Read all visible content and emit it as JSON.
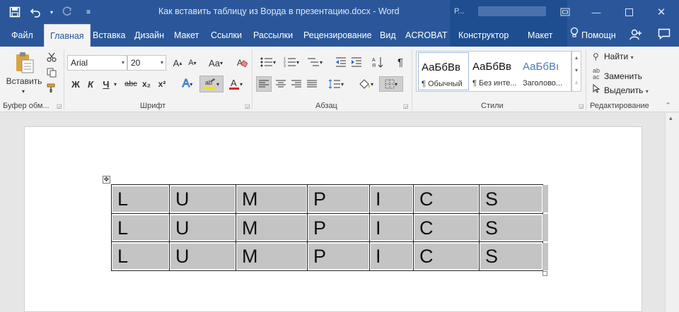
{
  "window": {
    "title": "Как вставить таблицу из Ворда в презентацию.docx - Word",
    "context_label": "Р...",
    "controls": [
      "restore",
      "minimize",
      "maximize",
      "close"
    ]
  },
  "quick_access": {
    "icons": [
      "save-icon",
      "undo-icon",
      "redo-icon",
      "customize-icon"
    ]
  },
  "tabs": [
    {
      "label": "Файл",
      "active": false
    },
    {
      "label": "Главная",
      "active": true
    },
    {
      "label": "Вставка",
      "active": false
    },
    {
      "label": "Дизайн",
      "active": false
    },
    {
      "label": "Макет",
      "active": false
    },
    {
      "label": "Ссылки",
      "active": false
    },
    {
      "label": "Рассылки",
      "active": false
    },
    {
      "label": "Рецензирование",
      "active": false
    },
    {
      "label": "Вид",
      "active": false
    },
    {
      "label": "ACROBAT",
      "active": false
    },
    {
      "label": "Конструктор",
      "active": false
    },
    {
      "label": "Макет",
      "active": false
    }
  ],
  "help": {
    "label": "Помощн"
  },
  "clipboard": {
    "paste_label": "Вставить",
    "group_label": "Буфер обм..."
  },
  "font": {
    "name": "Arial",
    "size": "20",
    "group_label": "Шрифт",
    "buttons": [
      "Ж",
      "К",
      "Ч",
      "abc",
      "x₂",
      "x²"
    ],
    "highlight_color": "#f5e400",
    "font_color": "#e01e1e"
  },
  "paragraph": {
    "group_label": "Абзац"
  },
  "styles": {
    "group_label": "Стили",
    "items": [
      {
        "sample": "АаБбВв",
        "name": "¶ Обычный",
        "selected": true
      },
      {
        "sample": "АаБбВв",
        "name": "¶ Без инте...",
        "selected": false
      },
      {
        "sample": "АаБбВı",
        "name": "Заголово...",
        "selected": false
      }
    ]
  },
  "editing": {
    "group_label": "Редактирование",
    "find": "Найти",
    "replace": "Заменить",
    "select": "Выделить"
  },
  "document": {
    "table": {
      "rows": [
        [
          "L",
          "U",
          "M",
          "P",
          "I",
          "C",
          "S"
        ],
        [
          "L",
          "U",
          "M",
          "P",
          "I",
          "C",
          "S"
        ],
        [
          "L",
          "U",
          "M",
          "P",
          "I",
          "C",
          "S"
        ]
      ],
      "highlight_color": "#c4c4c4"
    }
  },
  "colors": {
    "brand": "#2b579a",
    "ribbon_bg": "#f3f3f3",
    "doc_bg": "#e6e6e6"
  }
}
